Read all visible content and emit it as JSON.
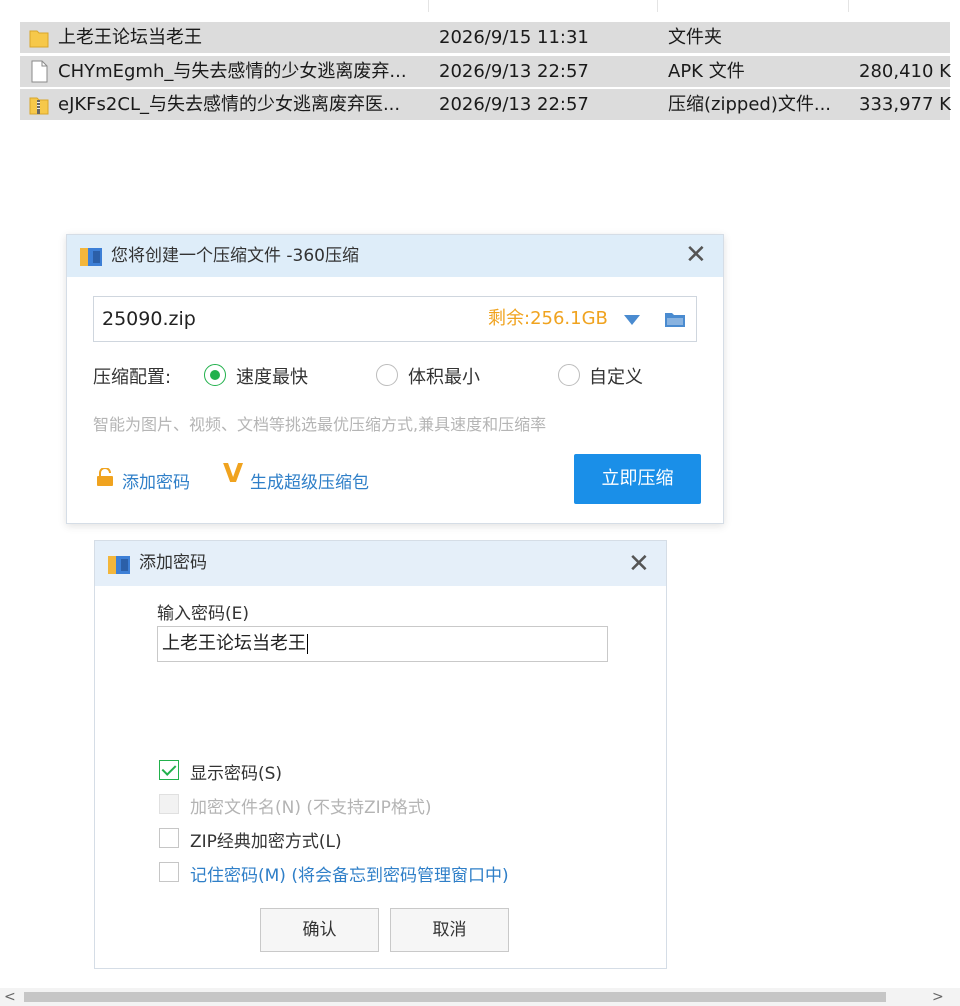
{
  "files": [
    {
      "name": "上老王论坛当老王",
      "date": "2026/9/15 11:31",
      "type": "文件夹",
      "size": "",
      "icon": "folder-icon"
    },
    {
      "name": "CHYmEgmh_与失去感情的少女逃离废弃...",
      "date": "2026/9/13 22:57",
      "type": "APK 文件",
      "size": "280,410 K",
      "icon": "file-icon"
    },
    {
      "name": "eJKFs2CL_与失去感情的少女逃离废弃医...",
      "date": "2026/9/13 22:57",
      "type": "压缩(zipped)文件...",
      "size": "333,977 K",
      "icon": "zip-icon"
    }
  ],
  "compress_dialog": {
    "title": "您将创建一个压缩文件 -360压缩",
    "path_value": "25090.zip",
    "space_left": "剩余:256.1GB",
    "config_label": "压缩配置:",
    "options": [
      {
        "label": "速度最快",
        "checked": true
      },
      {
        "label": "体积最小",
        "checked": false
      },
      {
        "label": "自定义",
        "checked": false
      }
    ],
    "hint": "智能为图片、视频、文档等挑选最优压缩方式,兼具速度和压缩率",
    "add_password": "添加密码",
    "super_package": "生成超级压缩包",
    "compress_now": "立即压缩"
  },
  "password_dialog": {
    "title": "添加密码",
    "input_label": "输入密码(E)",
    "password_value": "上老王论坛当老王",
    "checkboxes": [
      {
        "label": "显示密码(S)",
        "checked": true,
        "disabled": false
      },
      {
        "label": "加密文件名(N) (不支持ZIP格式)",
        "checked": false,
        "disabled": true
      },
      {
        "label": "ZIP经典加密方式(L)",
        "checked": false,
        "disabled": false
      },
      {
        "label": "记住密码(M) (将会备忘到密码管理窗口中)",
        "checked": false,
        "disabled": false
      }
    ],
    "ok": "确认",
    "cancel": "取消"
  },
  "colors": {
    "accent_blue": "#1a8fe8",
    "link_blue": "#2f7fc8",
    "check_green": "#22b14c",
    "space_orange": "#f0a31f"
  }
}
